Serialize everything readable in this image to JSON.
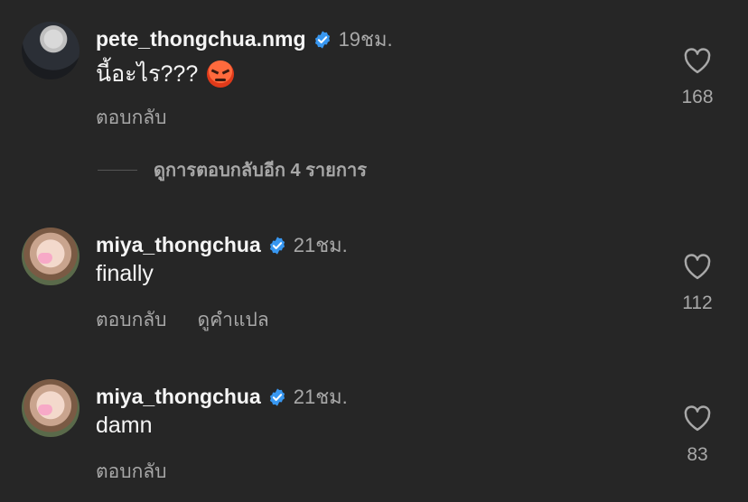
{
  "comments": [
    {
      "username": "pete_thongchua.nmg",
      "time": "19ชม.",
      "text": "นี้อะไร???",
      "emoji": "angry-face",
      "reply_label": "ตอบกลับ",
      "likes": "168",
      "view_replies": "ดูการตอบกลับอีก 4 รายการ"
    },
    {
      "username": "miya_thongchua",
      "time": "21ชม.",
      "text": "finally",
      "reply_label": "ตอบกลับ",
      "translate_label": "ดูคำแปล",
      "likes": "112"
    },
    {
      "username": "miya_thongchua",
      "time": "21ชม.",
      "text": "damn",
      "reply_label": "ตอบกลับ",
      "likes": "83"
    }
  ],
  "colors": {
    "background": "#262626",
    "verified": "#3897f0",
    "muted": "#a8a8a8",
    "text": "#f5f5f5"
  },
  "icons": [
    "verified-badge-icon",
    "heart-icon",
    "angry-face-emoji"
  ]
}
